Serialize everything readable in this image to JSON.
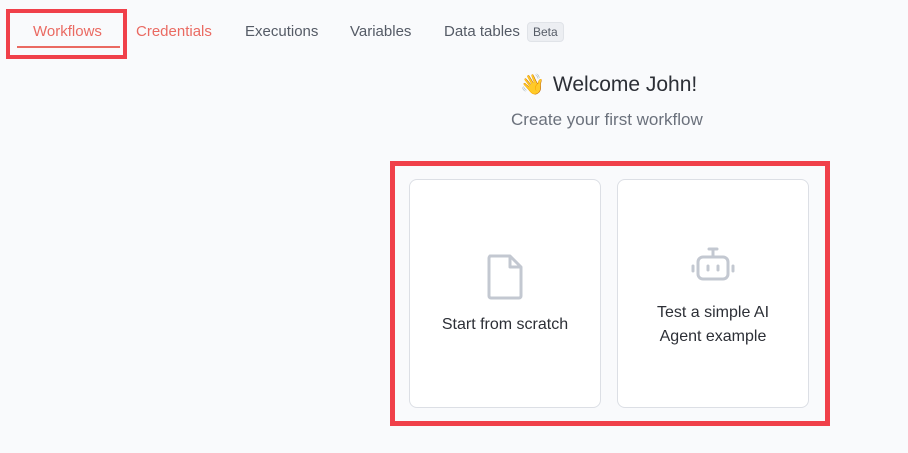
{
  "tabs": [
    {
      "label": "Workflows"
    },
    {
      "label": "Credentials"
    },
    {
      "label": "Executions"
    },
    {
      "label": "Variables"
    },
    {
      "label": "Data tables",
      "badge": "Beta"
    }
  ],
  "welcome": {
    "emoji": "👋",
    "title": "Welcome John!",
    "subtitle": "Create your first workflow"
  },
  "cards": [
    {
      "icon": "file-icon",
      "label": "Start from scratch"
    },
    {
      "icon": "robot-icon",
      "label_line1": "Test a simple AI",
      "label_line2": "Agent example"
    }
  ],
  "colors": {
    "accent": "#ea6a62",
    "highlight": "#f0404a",
    "background": "#f9fafc"
  }
}
